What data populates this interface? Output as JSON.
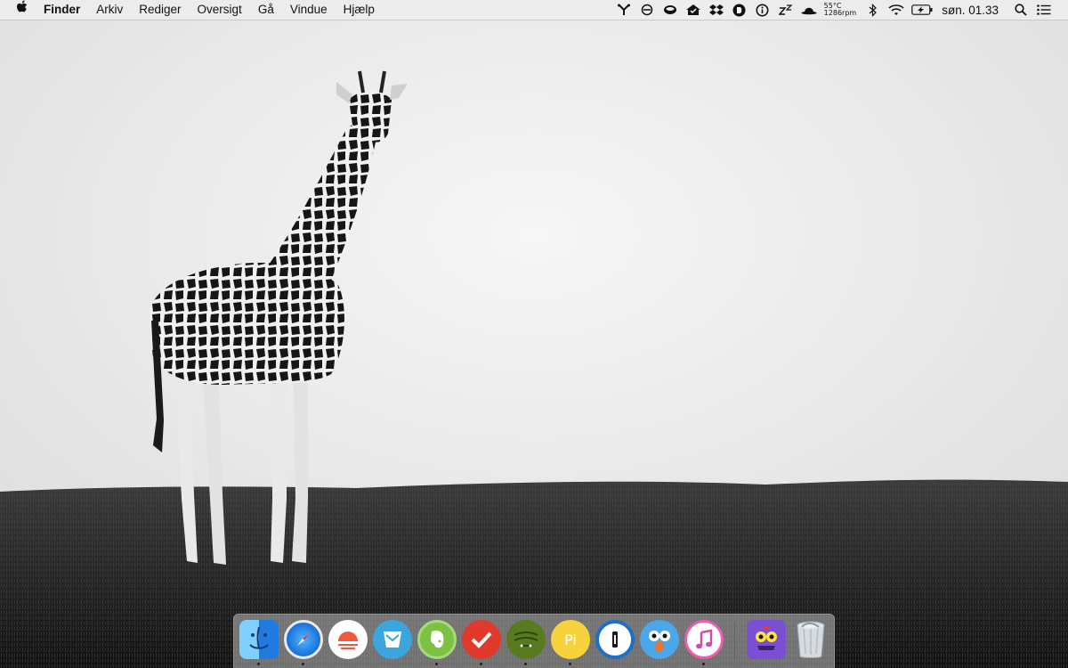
{
  "menubar": {
    "apple_icon": "apple-logo",
    "app_name": "Finder",
    "items": [
      "Arkiv",
      "Rediger",
      "Oversigt",
      "Gå",
      "Vindue",
      "Hjælp"
    ],
    "status": {
      "temperature": "55°C",
      "fan_speed": "1286rpm",
      "clock": "søn. 01.33",
      "battery_state": "charging"
    }
  },
  "dock": {
    "apps": [
      {
        "name": "Finder",
        "icon": "finder-icon",
        "running": true
      },
      {
        "name": "Safari",
        "icon": "safari-icon",
        "running": true
      },
      {
        "name": "Sunrise",
        "icon": "sunrise-icon",
        "running": false
      },
      {
        "name": "Airmail",
        "icon": "airmail-icon",
        "running": false
      },
      {
        "name": "Evernote",
        "icon": "evernote-icon",
        "running": true
      },
      {
        "name": "Wunderlist",
        "icon": "wunderlist-icon",
        "running": true
      },
      {
        "name": "Sparrow",
        "icon": "sparrow-icon",
        "running": false
      },
      {
        "name": "Pixelmator",
        "icon": "pi-icon",
        "label": "Pi",
        "running": true
      },
      {
        "name": "1Password",
        "icon": "onepassword-icon",
        "running": false
      },
      {
        "name": "Tweetbot",
        "icon": "tweetbot-icon",
        "running": false
      },
      {
        "name": "iTunes",
        "icon": "itunes-icon",
        "running": true
      },
      {
        "name": "Monster",
        "icon": "monster-icon",
        "running": false
      },
      {
        "name": "Papirkurv",
        "icon": "trash-icon",
        "running": false
      }
    ]
  },
  "colors": {
    "sky": "#f3f3f3",
    "grass_dark": "#2a2a2a",
    "accent_blue": "#1d7ee0"
  }
}
